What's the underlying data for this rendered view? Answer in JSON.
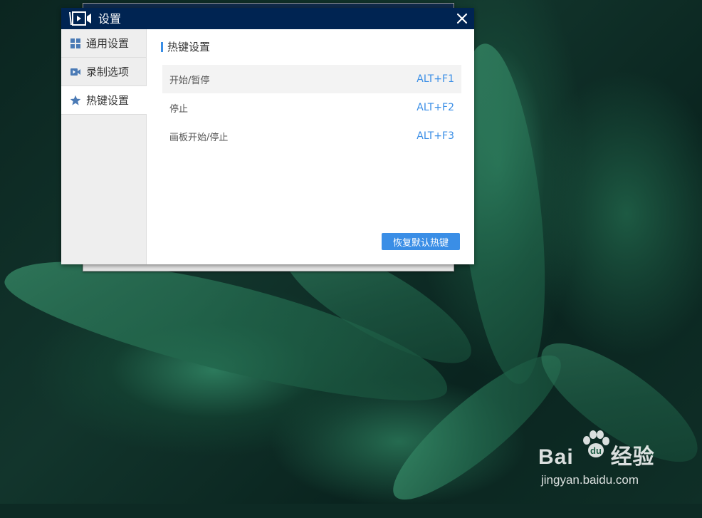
{
  "dialog": {
    "title": "设置",
    "close_label": "×"
  },
  "sidebar": {
    "items": [
      {
        "label": "通用设置",
        "icon": "grid-icon",
        "active": false
      },
      {
        "label": "录制选项",
        "icon": "camera-icon",
        "active": false
      },
      {
        "label": "热键设置",
        "icon": "star-icon",
        "active": true
      }
    ]
  },
  "content": {
    "section_title": "热键设置",
    "hotkeys": [
      {
        "name": "开始/暂停",
        "key": "ALT+F1",
        "highlighted": true
      },
      {
        "name": "停止",
        "key": "ALT+F2",
        "highlighted": false
      },
      {
        "name": "画板开始/停止",
        "key": "ALT+F3",
        "highlighted": false
      }
    ],
    "restore_button": "恢复默认热键"
  },
  "watermark": {
    "brand_left": "Bai",
    "brand_right": "经验",
    "url": "jingyan.baidu.com"
  },
  "colors": {
    "titlebar": "#002452",
    "accent": "#3a8ee6",
    "sidebar_bg": "#eeeeee"
  }
}
